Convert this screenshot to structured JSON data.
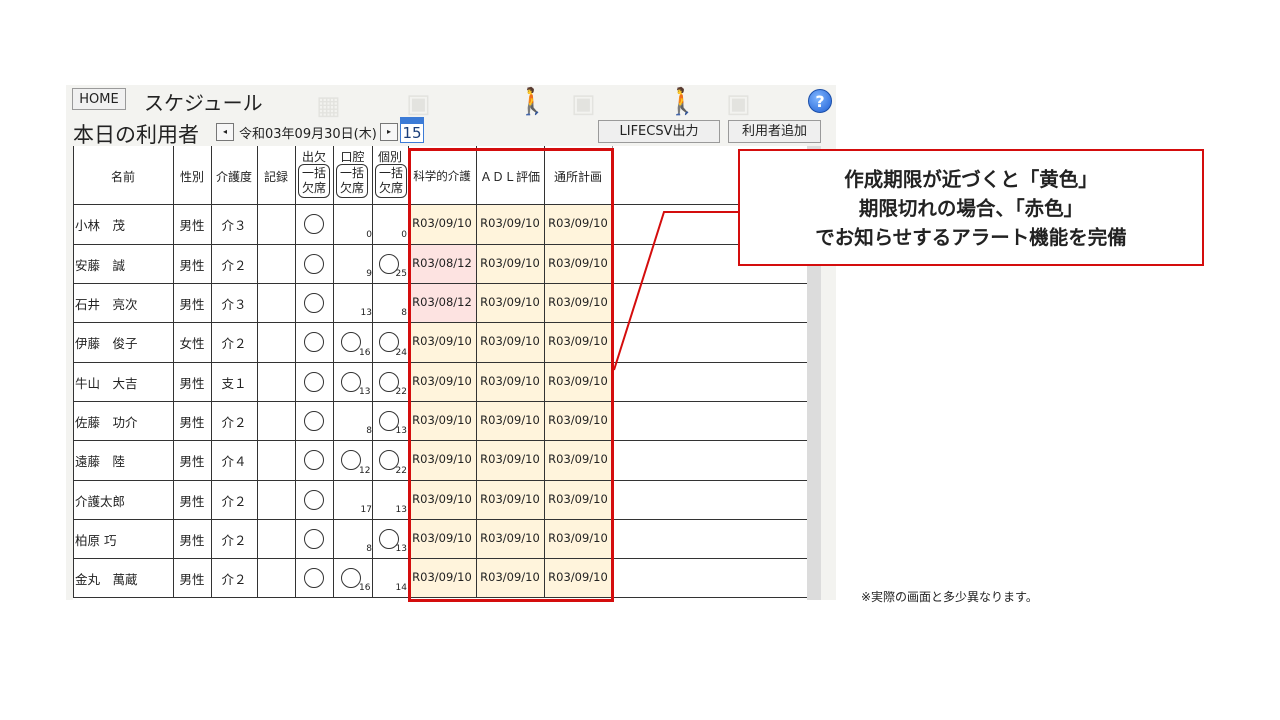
{
  "header": {
    "home_label": "HOME",
    "title": "スケジュール",
    "help_icon_label": "?",
    "subtitle": "本日の利用者",
    "prev_label": "◂",
    "next_label": "▸",
    "date_label": "令和03年09月30日(木)",
    "calendar_day": "15",
    "csv_button": "LIFECSV出力",
    "add_user_button": "利用者追加"
  },
  "columns": {
    "name": "名前",
    "gender": "性別",
    "care_level": "介護度",
    "record": "記録",
    "attendance": {
      "top": "出欠",
      "l1": "一括",
      "l2": "欠席"
    },
    "oral": {
      "top": "口腔",
      "l1": "一括",
      "l2": "欠席"
    },
    "individual": {
      "top": "個別",
      "l1": "一括",
      "l2": "欠席"
    },
    "science_care": "科学的介護",
    "adl": "ＡＤＬ評価",
    "outpatient_plan": "通所計画"
  },
  "rows": [
    {
      "name": "小林　茂",
      "gender": "男性",
      "care": "介３",
      "att": true,
      "oral": false,
      "oral_n": "0",
      "ind": false,
      "ind_n": "0",
      "sci": "R03/09/10",
      "adl": "R03/09/10",
      "plan": "R03/09/10",
      "sci_status": "warn"
    },
    {
      "name": "安藤　誠",
      "gender": "男性",
      "care": "介２",
      "att": true,
      "oral": false,
      "oral_n": "9",
      "ind": true,
      "ind_n": "25",
      "sci": "R03/08/12",
      "adl": "R03/09/10",
      "plan": "R03/09/10",
      "sci_status": "expired"
    },
    {
      "name": "石井　亮次",
      "gender": "男性",
      "care": "介３",
      "att": true,
      "oral": false,
      "oral_n": "13",
      "ind": false,
      "ind_n": "8",
      "sci": "R03/08/12",
      "adl": "R03/09/10",
      "plan": "R03/09/10",
      "sci_status": "expired"
    },
    {
      "name": "伊藤　俊子",
      "gender": "女性",
      "care": "介２",
      "att": true,
      "oral": true,
      "oral_n": "16",
      "ind": true,
      "ind_n": "24",
      "sci": "R03/09/10",
      "adl": "R03/09/10",
      "plan": "R03/09/10",
      "sci_status": "warn"
    },
    {
      "name": "牛山　大吉",
      "gender": "男性",
      "care": "支１",
      "att": true,
      "oral": true,
      "oral_n": "13",
      "ind": true,
      "ind_n": "22",
      "sci": "R03/09/10",
      "adl": "R03/09/10",
      "plan": "R03/09/10",
      "sci_status": "warn"
    },
    {
      "name": "佐藤　功介",
      "gender": "男性",
      "care": "介２",
      "att": true,
      "oral": false,
      "oral_n": "8",
      "ind": true,
      "ind_n": "13",
      "sci": "R03/09/10",
      "adl": "R03/09/10",
      "plan": "R03/09/10",
      "sci_status": "warn"
    },
    {
      "name": "遠藤　陸",
      "gender": "男性",
      "care": "介４",
      "att": true,
      "oral": true,
      "oral_n": "12",
      "ind": true,
      "ind_n": "22",
      "sci": "R03/09/10",
      "adl": "R03/09/10",
      "plan": "R03/09/10",
      "sci_status": "warn"
    },
    {
      "name": "介護太郎",
      "gender": "男性",
      "care": "介２",
      "att": true,
      "oral": false,
      "oral_n": "17",
      "ind": false,
      "ind_n": "13",
      "sci": "R03/09/10",
      "adl": "R03/09/10",
      "plan": "R03/09/10",
      "sci_status": "warn"
    },
    {
      "name": "柏原 巧",
      "gender": "男性",
      "care": "介２",
      "att": true,
      "oral": false,
      "oral_n": "8",
      "ind": true,
      "ind_n": "13",
      "sci": "R03/09/10",
      "adl": "R03/09/10",
      "plan": "R03/09/10",
      "sci_status": "warn"
    },
    {
      "name": "金丸　萬蔵",
      "gender": "男性",
      "care": "介２",
      "att": true,
      "oral": true,
      "oral_n": "16",
      "ind": false,
      "ind_n": "14",
      "sci": "R03/09/10",
      "adl": "R03/09/10",
      "plan": "R03/09/10",
      "sci_status": "warn"
    }
  ],
  "callout": {
    "line1": "作成期限が近づくと「黄色」",
    "line2": "期限切れの場合、「赤色」",
    "line3": "でお知らせするアラート機能を完備"
  },
  "note": "※実際の画面と多少異なります。",
  "colors": {
    "warn_bg": "#fff4dc",
    "expired_bg": "#fde3e1",
    "alert_red": "#d40d0d"
  }
}
